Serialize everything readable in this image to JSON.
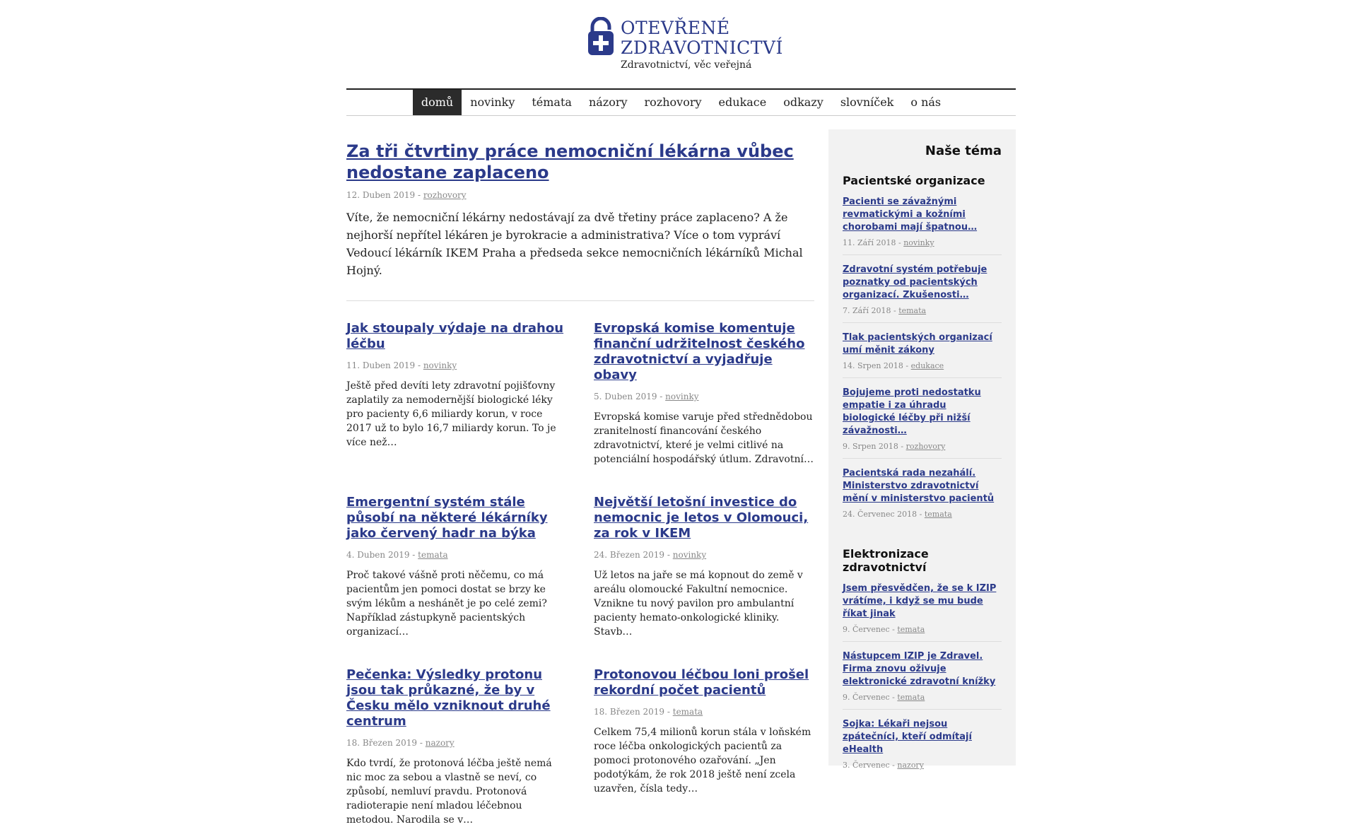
{
  "brand": {
    "title_line1": "OTEVŘENÉ",
    "title_line2": "ZDRAVOTNICTVÍ",
    "subtitle": "Zdravotnictví, věc veřejná",
    "color": "#2b3a8a"
  },
  "nav": {
    "items": [
      "domů",
      "novinky",
      "témata",
      "názory",
      "rozhovory",
      "edukace",
      "odkazy",
      "slovníček",
      "o nás"
    ],
    "active": "domů"
  },
  "lead": {
    "title": "Za tři čtvrtiny práce nemocniční lékárna vůbec nedostane zaplaceno",
    "date": "12. Duben 2019",
    "category": "rozhovory",
    "text": "Víte, že nemocniční lékárny nedostávají za dvě třetiny práce zaplaceno? A že nejhorší nepřítel lékáren je byrokracie a administrativa? Více o tom vypráví Vedoucí lékárník IKEM Praha a předseda sekce nemocničních lékárníků Michal Hojný."
  },
  "cards": [
    {
      "title": "Jak stoupaly výdaje na drahou léčbu",
      "date": "11. Duben 2019",
      "category": "novinky",
      "text": "Ještě před devíti lety zdravotní pojišťovny zaplatily za nemodernější biologické léky pro pacienty 6,6 miliardy korun, v roce 2017 už to bylo 16,7 miliardy korun. To je více než…"
    },
    {
      "title": "Evropská komise komentuje finanční udržitelnost českého zdravotnictví a vyjadřuje obavy",
      "date": "5. Duben 2019",
      "category": "novinky",
      "text": "Evropská komise varuje před střednědobou zranitelností financování českého zdravotnictví, které je velmi citlivé na potenciální hospodářský útlum. Zdravotní…"
    },
    {
      "title": "Emergentní systém stále působí na některé lékárníky jako červený hadr na býka",
      "date": "4. Duben 2019",
      "category": "temata",
      "text": "Proč takové vášně proti něčemu, co má pacientům jen pomoci dostat se brzy ke svým lékům a neshánět je po celé zemi? Například zástupkyně pacientských organizací…"
    },
    {
      "title": "Největší letošní investice do nemocnic je letos v Olomouci, za rok v IKEM",
      "date": "24. Březen 2019",
      "category": "novinky",
      "text": "Už letos na jaře se má kopnout do země v areálu olomoucké Fakultní nemocnice. Vznikne tu nový pavilon pro ambulantní pacienty hemato-onkologické kliniky. Stavb…"
    },
    {
      "title": "Pečenka: Výsledky protonu jsou tak průkazné, že by v Česku mělo vzniknout druhé centrum",
      "date": "18. Březen 2019",
      "category": "nazory",
      "text": "Kdo tvrdí, že protonová léčba ještě nemá nic moc za sebou a vlastně se neví, co způsobí, nemluví pravdu. Protonová radioterapie není mladou léčebnou metodou. Narodila se v…"
    },
    {
      "title": "Protonovou léčbou loni prošel rekordní počet pacientů",
      "date": "18. Březen 2019",
      "category": "temata",
      "text": "Celkem 75,4 milionů korun stála v loňském roce léčba onkologických pacientů za pomoci protonového ozařování. „Jen podotýkám, že rok 2018 ještě není zcela uzavřen, čísla tedy…"
    }
  ],
  "sidebar": {
    "heading": "Naše téma",
    "sections": [
      {
        "title": "Pacientské organizace",
        "items": [
          {
            "title": "Pacienti se závažnými revmatickými a kožními chorobami mají špatnou…",
            "date": "11. Září 2018",
            "category": "novinky"
          },
          {
            "title": "Zdravotní systém potřebuje poznatky od pacientských organizací. Zkušenosti…",
            "date": "7. Září 2018",
            "category": "temata"
          },
          {
            "title": "Tlak pacientských organizací umí měnit zákony",
            "date": "14. Srpen 2018",
            "category": "edukace"
          },
          {
            "title": "Bojujeme proti nedostatku empatie i za úhradu biologické léčby při nižší závažnosti…",
            "date": "9. Srpen 2018",
            "category": "rozhovory"
          },
          {
            "title": "Pacientská rada nezahálí. Ministerstvo zdravotnictví mění v ministerstvo pacientů",
            "date": "24. Červenec 2018",
            "category": "temata"
          }
        ]
      },
      {
        "title": "Elektronizace zdravotnictví",
        "items": [
          {
            "title": "Jsem přesvědčen, že se k IZIP vrátíme, i když se mu bude říkat jinak",
            "date": "9. Červenec",
            "category": "temata"
          },
          {
            "title": "Nástupcem IZIP je Zdravel. Firma znovu oživuje elektronické zdravotní knížky",
            "date": "9. Červenec",
            "category": "temata"
          },
          {
            "title": "Sojka: Lékaři nejsou zpátečníci, kteří odmítají eHealth",
            "date": "3. Červenec",
            "category": "nazory"
          }
        ]
      }
    ]
  }
}
